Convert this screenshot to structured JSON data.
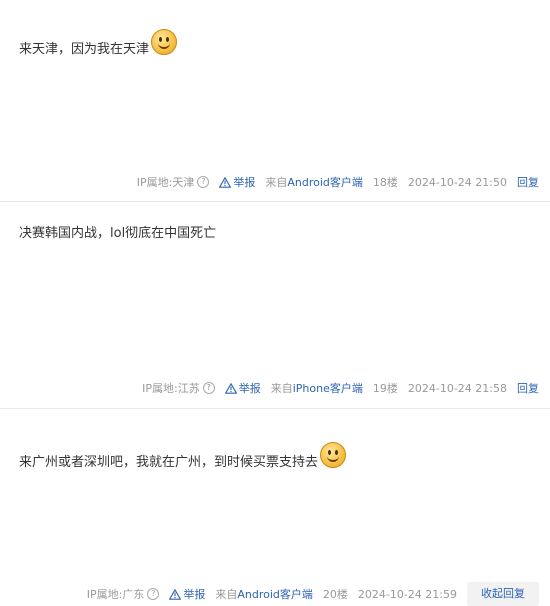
{
  "posts": [
    {
      "content": "来天津，因为我在天津",
      "has_emoji": true,
      "ip_label": "IP属地:天津",
      "report_label": "举报",
      "client_prefix": "来自",
      "client_name": "Android客户端",
      "floor": "18楼",
      "time": "2024-10-24 21:50",
      "reply_label": "回复"
    },
    {
      "content": "决赛韩国内战，lol彻底在中国死亡",
      "has_emoji": false,
      "ip_label": "IP属地:江苏",
      "report_label": "举报",
      "client_prefix": "来自",
      "client_name": "iPhone客户端",
      "floor": "19楼",
      "time": "2024-10-24 21:58",
      "reply_label": "回复"
    },
    {
      "content": "来广州或者深圳吧，我就在广州，到时候买票支持去",
      "has_emoji": true,
      "ip_label": "IP属地:广东",
      "report_label": "举报",
      "client_prefix": "来自",
      "client_name": "Android客户端",
      "floor": "20楼",
      "time": "2024-10-24 21:59",
      "reply_label": "收起回复"
    }
  ],
  "icons": {
    "question": "question-circle-icon",
    "warning": "warning-triangle-icon",
    "emoji": "smiley-emoji-icon"
  },
  "colors": {
    "link": "#2d64b3",
    "meta": "#999999",
    "divider": "#e9e9e9"
  }
}
